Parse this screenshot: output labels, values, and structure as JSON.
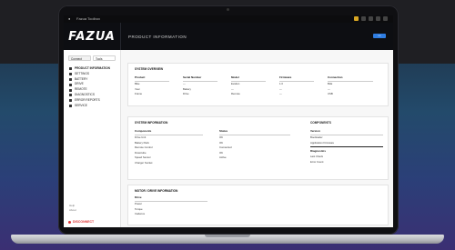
{
  "menubar": {
    "app_name": "Fazua Toolbox",
    "apple": ""
  },
  "header": {
    "logo": "FAZUA",
    "title": "PRODUCT INFORMATION",
    "button_label": "•••"
  },
  "sidebar": {
    "mode_tabs": [
      "Connect",
      "Tools"
    ],
    "items": [
      {
        "label": "PRODUCT INFORMATION",
        "icon": "info-icon"
      },
      {
        "label": "SETTINGS",
        "icon": "gear-icon"
      },
      {
        "label": "BATTERY",
        "icon": "battery-icon"
      },
      {
        "label": "DRIVE",
        "icon": "motor-icon"
      },
      {
        "label": "REMOTE",
        "icon": "remote-icon"
      },
      {
        "label": "DIAGNOSTICS",
        "icon": "wrench-icon"
      },
      {
        "label": "ERROR REPORTS",
        "icon": "report-icon"
      },
      {
        "label": "SERVICE",
        "icon": "service-icon"
      }
    ],
    "footer": [
      "Help",
      "About"
    ],
    "logout": "DISCONNECT"
  },
  "panels": {
    "overview": {
      "title": "SYSTEM OVERVIEW",
      "columns": [
        {
          "header": "Product",
          "rows": [
            "Bike",
            "Year",
            "Frame"
          ]
        },
        {
          "header": "Serial Number",
          "rows": [
            "—",
            "Battery",
            "Drive"
          ]
        },
        {
          "header": "Model",
          "rows": [
            "Evation",
            "—",
            "Remote"
          ]
        },
        {
          "header": "Firmware",
          "rows": [
            "1.0",
            "—",
            "—"
          ]
        },
        {
          "header": "Connection",
          "rows": [
            "BLE",
            "—",
            "USB"
          ]
        }
      ]
    },
    "system": {
      "title": "SYSTEM INFORMATION",
      "col1": {
        "header": "Components",
        "rows": [
          "Drive Unit",
          "Battery Pack",
          "Remote Control",
          "Downtube",
          "Speed Sensor",
          "Charger Socket"
        ]
      },
      "col2": {
        "header": "Status",
        "rows": [
          "OK",
          "OK",
          "Connected",
          "OK",
          "Active"
        ]
      },
      "right_title": "COMPONENTS",
      "right_header": "Version",
      "right_rows": [
        "Bootloader",
        "Application Firmware"
      ],
      "right_header2": "Diagnostics",
      "right_rows2": [
        "Last Check",
        "Error Count"
      ]
    },
    "drive": {
      "title": "MOTOR / DRIVE INFORMATION",
      "header": "Drive",
      "rows": [
        "Power",
        "Torque",
        "Cadence"
      ]
    }
  }
}
